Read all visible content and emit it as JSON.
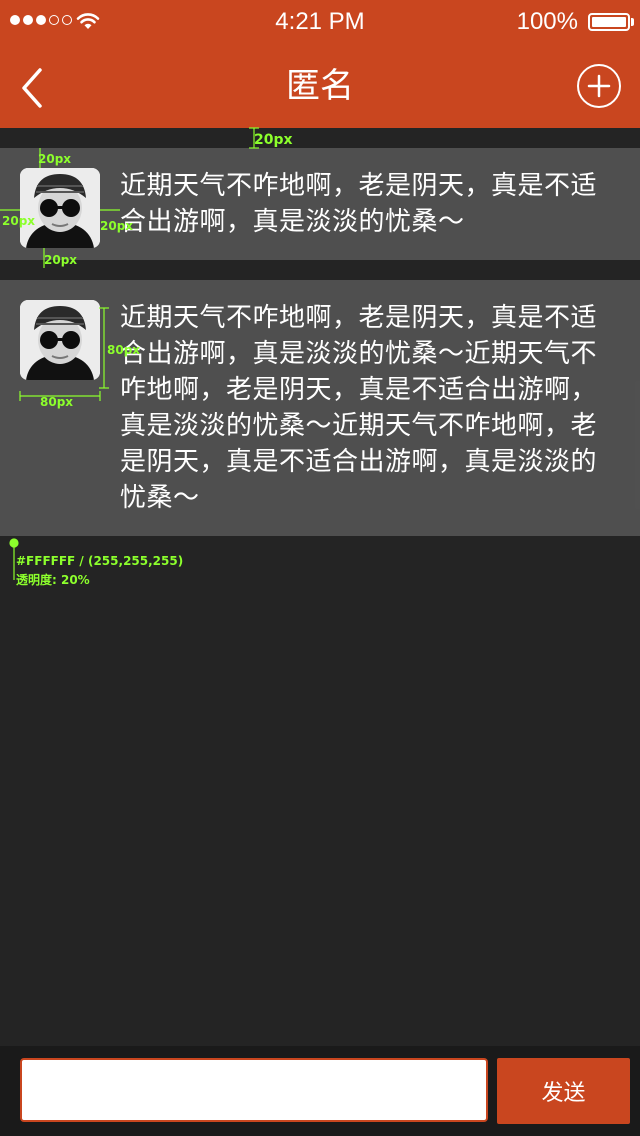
{
  "status_bar": {
    "time": "4:21 PM",
    "battery_percent": "100%",
    "signal_bars_filled": 3,
    "signal_bars_total": 5,
    "icons": [
      "signal-dots-icon",
      "wifi-icon",
      "battery-icon"
    ]
  },
  "nav": {
    "title": "匿名",
    "back_icon": "chevron-left-icon",
    "add_icon": "plus-circle-icon"
  },
  "posts": [
    {
      "text": "近期天气不咋地啊，老是阴天，真是不适合出游啊，真是淡淡的忧桑～"
    },
    {
      "text": "近期天气不咋地啊，老是阴天，真是不适合出游啊，真是淡淡的忧桑～近期天气不咋地啊，老是阴天，真是不适合出游啊，真是淡淡的忧桑～近期天气不咋地啊，老是阴天，真是不适合出游啊，真是淡淡的忧桑～"
    }
  ],
  "annotations": {
    "spacing": "20px",
    "avatar_size": "80px",
    "color_note": "#FFFFFF / (255,255,255)",
    "opacity_note": "透明度: 20%"
  },
  "composer": {
    "input_value": "",
    "send_label": "发送"
  },
  "colors": {
    "accent": "#C9461F",
    "background": "#242424",
    "post_bg": "rgba(255,255,255,0.2)",
    "annotation": "#8CFF2C"
  }
}
